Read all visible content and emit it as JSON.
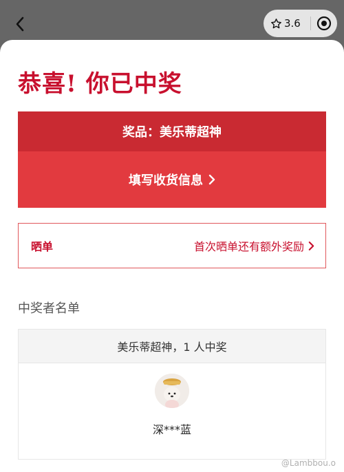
{
  "topbar": {
    "rating": "3.6"
  },
  "page": {
    "title": "恭喜! 你已中奖"
  },
  "prize": {
    "label": "奖品：美乐蒂超神",
    "action": "填写收货信息"
  },
  "share": {
    "left": "晒单",
    "right": "首次晒单还有额外奖励"
  },
  "winners": {
    "heading": "中奖者名单",
    "summary": "美乐蒂超神，1 人中奖",
    "list": [
      {
        "name": "深***蓝"
      }
    ]
  },
  "watermark": "@Lambbou.o",
  "colors": {
    "accent": "#c8102e",
    "prize_head": "#c92a32",
    "prize_action": "#e23a3f"
  },
  "icons": {
    "back": "chevron-left-icon",
    "rating": "star-outline-icon",
    "close": "target-icon",
    "chevron": "chevron-right-icon"
  }
}
